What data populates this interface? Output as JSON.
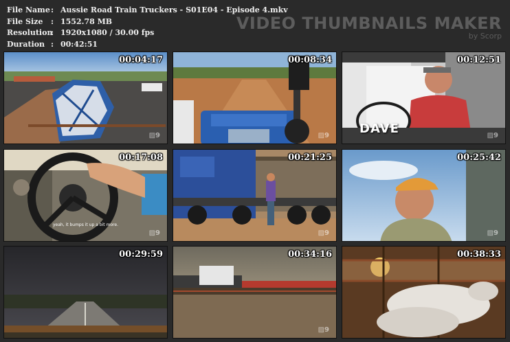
{
  "file_info": {
    "rows": [
      {
        "label": "File Name",
        "sep": ":",
        "value": "Aussie Road Train Truckers - S01E04 - Episode 4.mkv"
      },
      {
        "label": "File Size",
        "sep": ":",
        "value": "1552.78 MB"
      },
      {
        "label": "Resolution",
        "sep": ":",
        "value": "1920x1080 / 30.00 fps"
      },
      {
        "label": "Duration",
        "sep": ":",
        "value": "00:42:51"
      }
    ]
  },
  "brand": {
    "title": "VIDEO THUMBNAILS MAKER",
    "subtitle": "by Scorp"
  },
  "thumbnails": [
    {
      "timestamp": "00:04:17",
      "logo": "▨9"
    },
    {
      "timestamp": "00:08:34",
      "logo": "▨9"
    },
    {
      "timestamp": "00:12:51",
      "logo": "▨9",
      "overlay_text": "DAVE"
    },
    {
      "timestamp": "00:17:08",
      "logo": "▨9",
      "caption": "yeah, it bumps it up a bit more."
    },
    {
      "timestamp": "00:21:25",
      "logo": "▨9"
    },
    {
      "timestamp": "00:25:42",
      "logo": "▨9"
    },
    {
      "timestamp": "00:29:59",
      "logo": ""
    },
    {
      "timestamp": "00:34:16",
      "logo": "▨9"
    },
    {
      "timestamp": "00:38:33",
      "logo": ""
    }
  ],
  "colors": {
    "background": "#2a2a2a",
    "header_text": "#f0f0f0",
    "brand_text": "#5d5d5d"
  }
}
